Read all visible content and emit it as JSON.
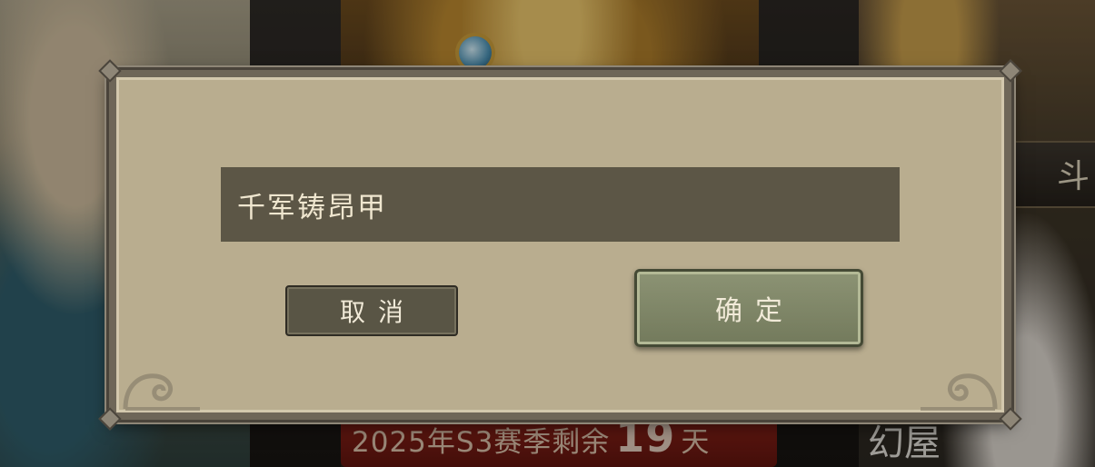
{
  "background": {
    "season_text": "2025年S3赛季剩余",
    "season_days_number": "19",
    "season_days_unit": "天",
    "right_strip_glyph": "斗",
    "corner_text": "幻屋"
  },
  "dialog": {
    "name_input_value": "千军铸昂甲",
    "cancel_label": "取消",
    "confirm_label": "确定"
  },
  "colors": {
    "dialog_bg": "#b9ad8f",
    "input_bg": "#5c5646",
    "cancel_bg": "#595545",
    "confirm_bg": "#8c9374"
  }
}
